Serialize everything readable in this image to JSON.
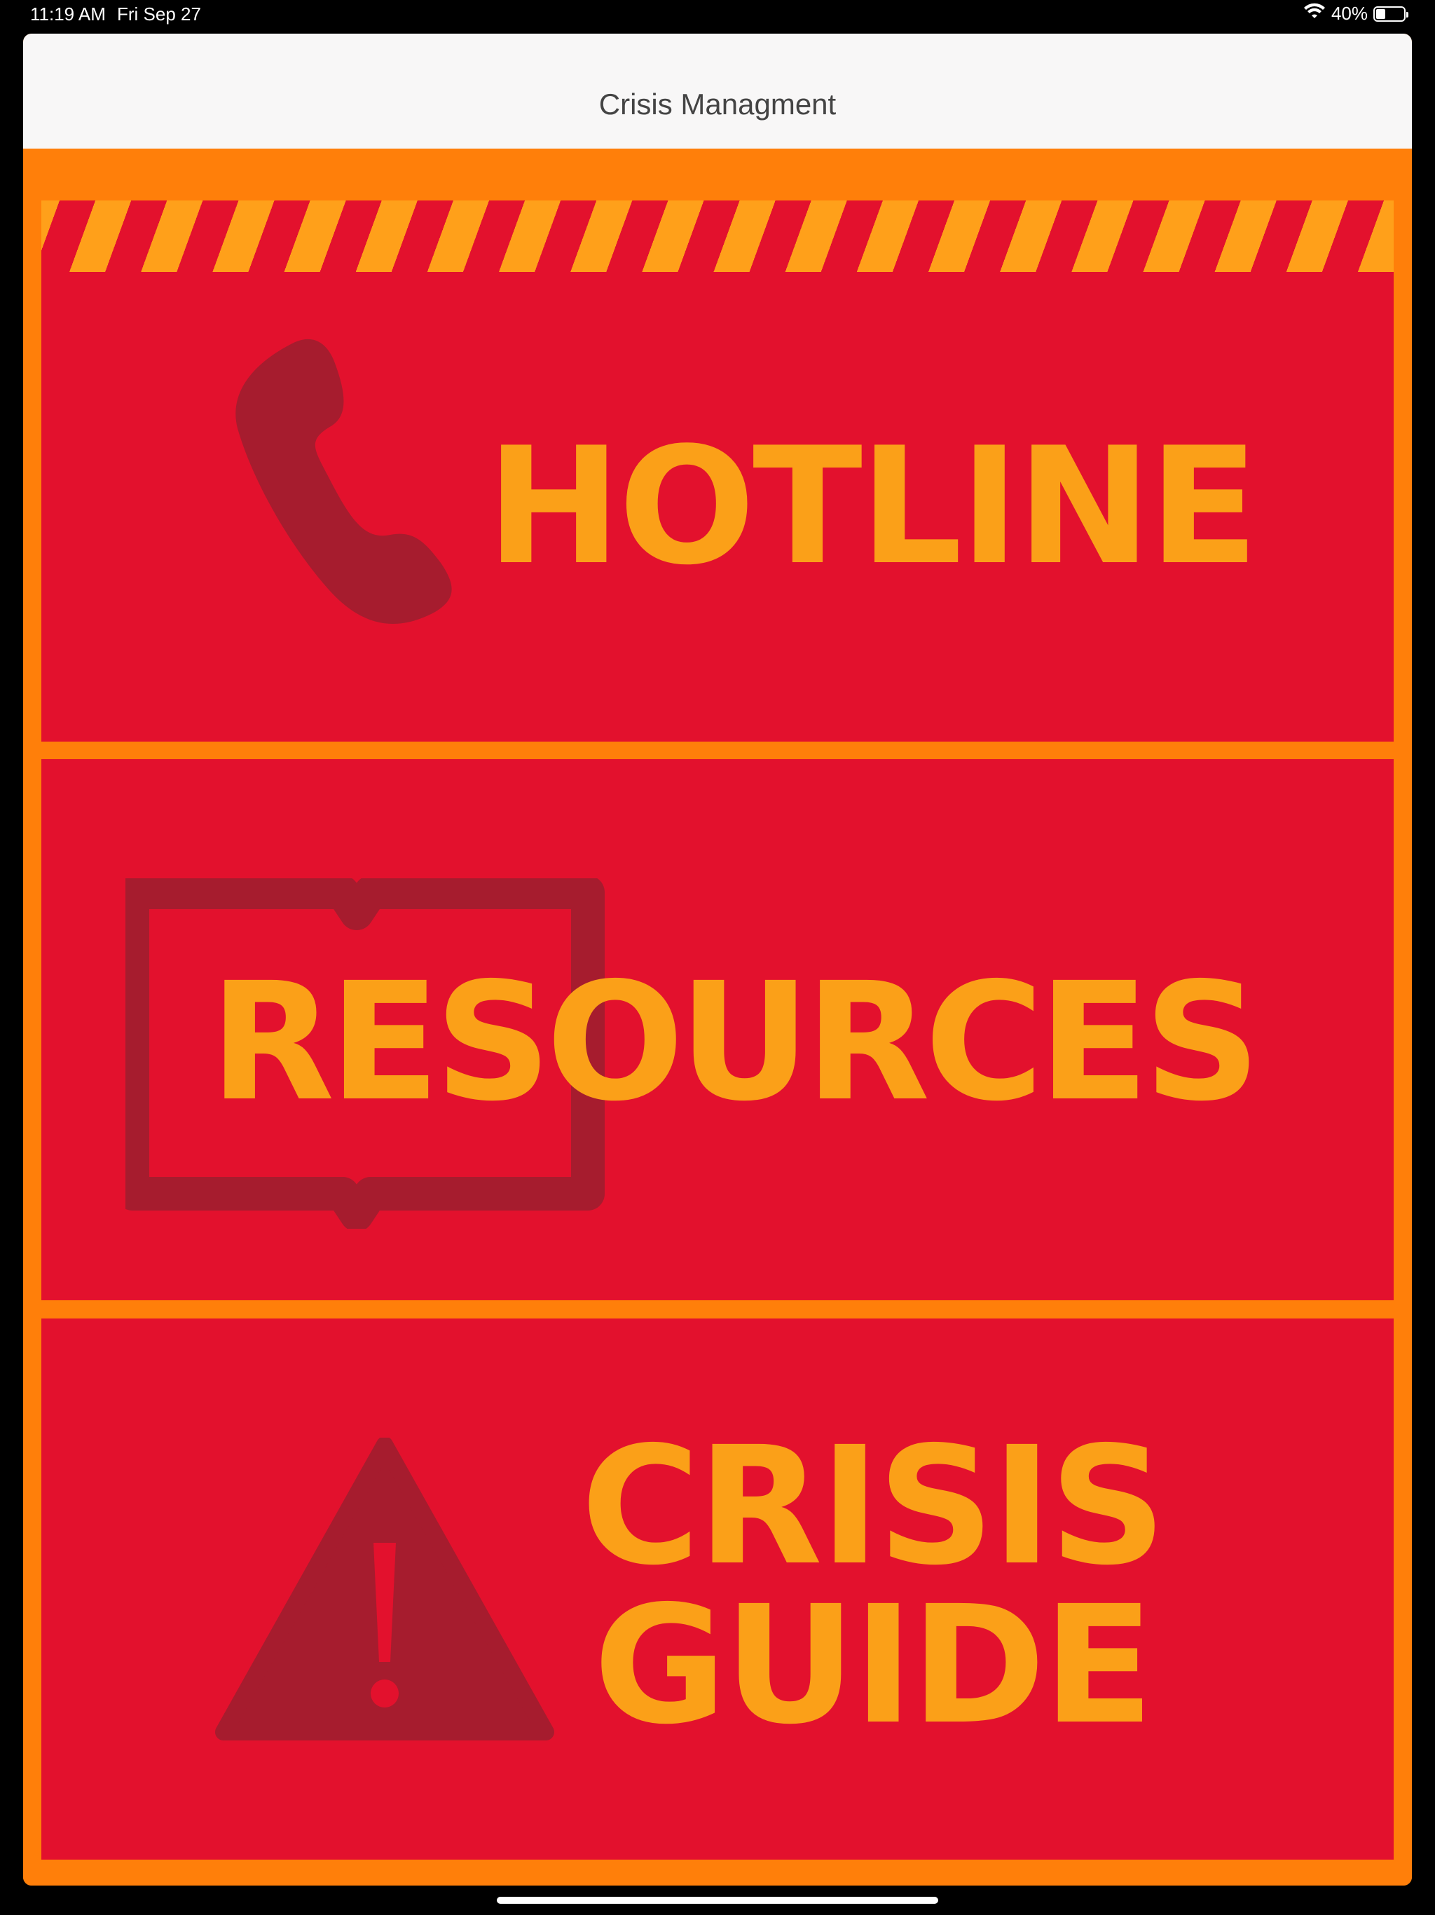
{
  "status_bar": {
    "time": "11:19 AM",
    "date": "Fri Sep 27",
    "wifi_icon": "wifi-icon",
    "battery_percent": "40%",
    "battery_level": 0.4
  },
  "nav": {
    "title": "Crisis Managment"
  },
  "panels": [
    {
      "label": "HOTLINE",
      "icon": "phone-icon"
    },
    {
      "label": "RESOURCES",
      "icon": "book-icon"
    },
    {
      "label": "CRISIS\nGUIDE",
      "icon": "warning-icon"
    }
  ],
  "colors": {
    "background": "#ff7f0a",
    "panel": "#e3112d",
    "label": "#fba018",
    "icon": "#a61c2e",
    "nav_bar": "#f8f7f7"
  }
}
